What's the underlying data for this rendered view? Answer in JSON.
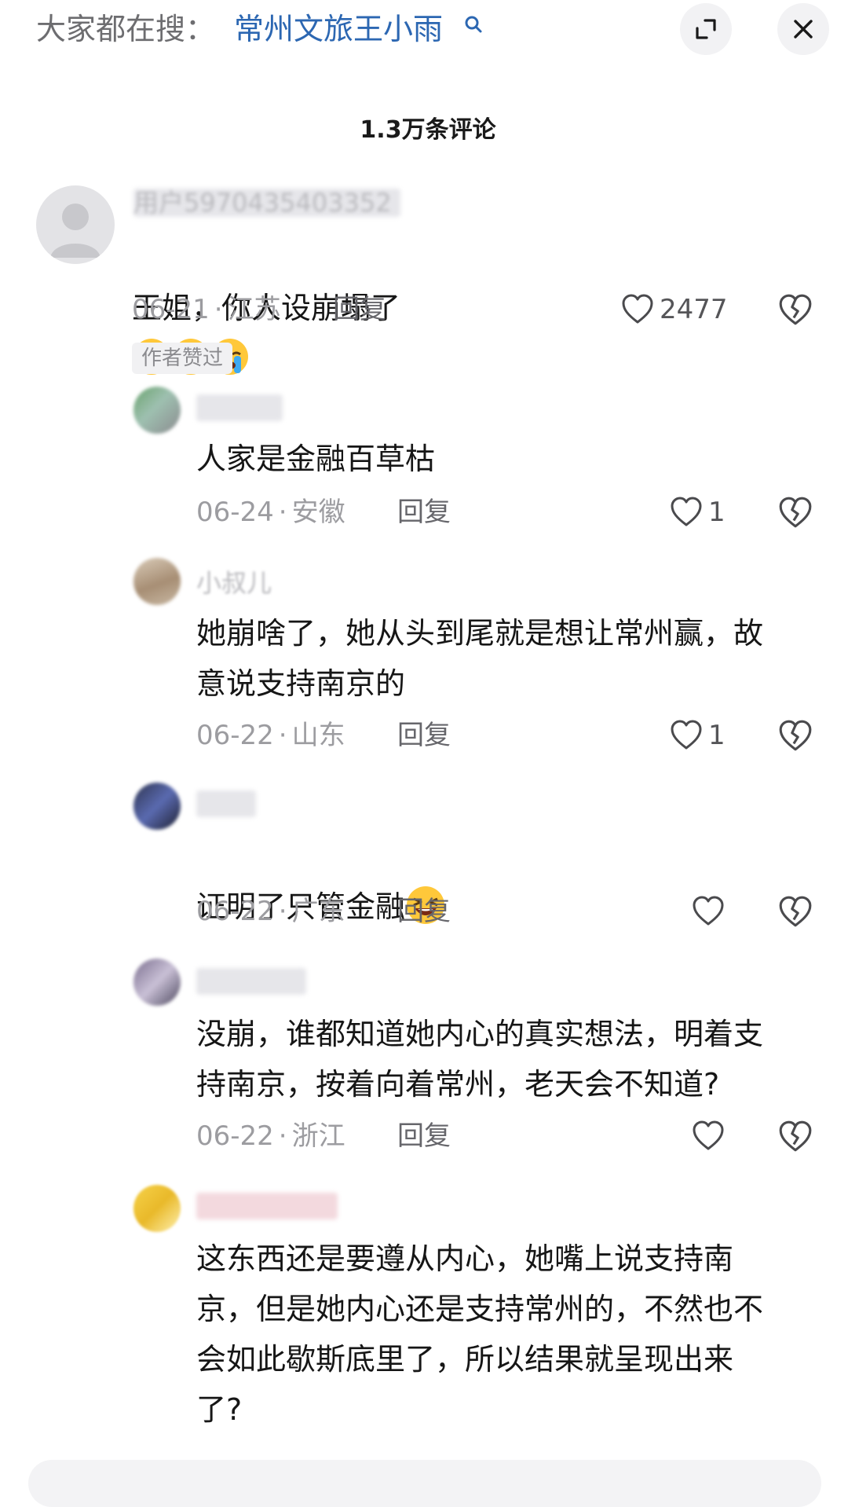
{
  "search": {
    "prefix": "大家都在搜：",
    "term": "常州文旅王小雨"
  },
  "header": {
    "comment_count_title": "1.3万条评论"
  },
  "icons": {
    "search": "search-icon",
    "expand": "expand-icon",
    "close": "close-icon",
    "like": "heart-icon",
    "dislike": "broken-heart-icon"
  },
  "comments": [
    {
      "username": "用户5970435403352",
      "text": "王姐，你人设崩塌了",
      "emojis": [
        "crying-emoji",
        "crying-emoji",
        "crying-emoji"
      ],
      "date": "06-21",
      "location": "江苏",
      "reply_label": "回复",
      "likes": "2477",
      "badge": "作者赞过"
    },
    {
      "username": "",
      "text": "人家是金融百草枯",
      "date": "06-24",
      "location": "安徽",
      "reply_label": "回复",
      "likes": "1"
    },
    {
      "username": "小叔儿",
      "text": "她崩啥了，她从头到尾就是想让常州赢，故\n意说支持南京的",
      "date": "06-22",
      "location": "山东",
      "reply_label": "回复",
      "likes": "1"
    },
    {
      "username": "",
      "text": "证明了只管金融",
      "emojis": [
        "laughing-emoji"
      ],
      "date": "06-22",
      "location": "广东",
      "reply_label": "回复",
      "likes": ""
    },
    {
      "username": "",
      "text": "没崩，谁都知道她内心的真实想法，明着支\n持南京，按着向着常州，老天会不知道?",
      "date": "06-22",
      "location": "浙江",
      "reply_label": "回复",
      "likes": ""
    },
    {
      "username": "",
      "text": "这东西还是要遵从内心，她嘴上说支持南\n京，但是她内心还是支持常州的，不然也不\n会如此歇斯底里了，所以结果就呈现出来\n了?"
    }
  ],
  "colors": {
    "search_term": "#2c67b2",
    "meta_gray": "#9c9ca0",
    "text": "#161616"
  }
}
